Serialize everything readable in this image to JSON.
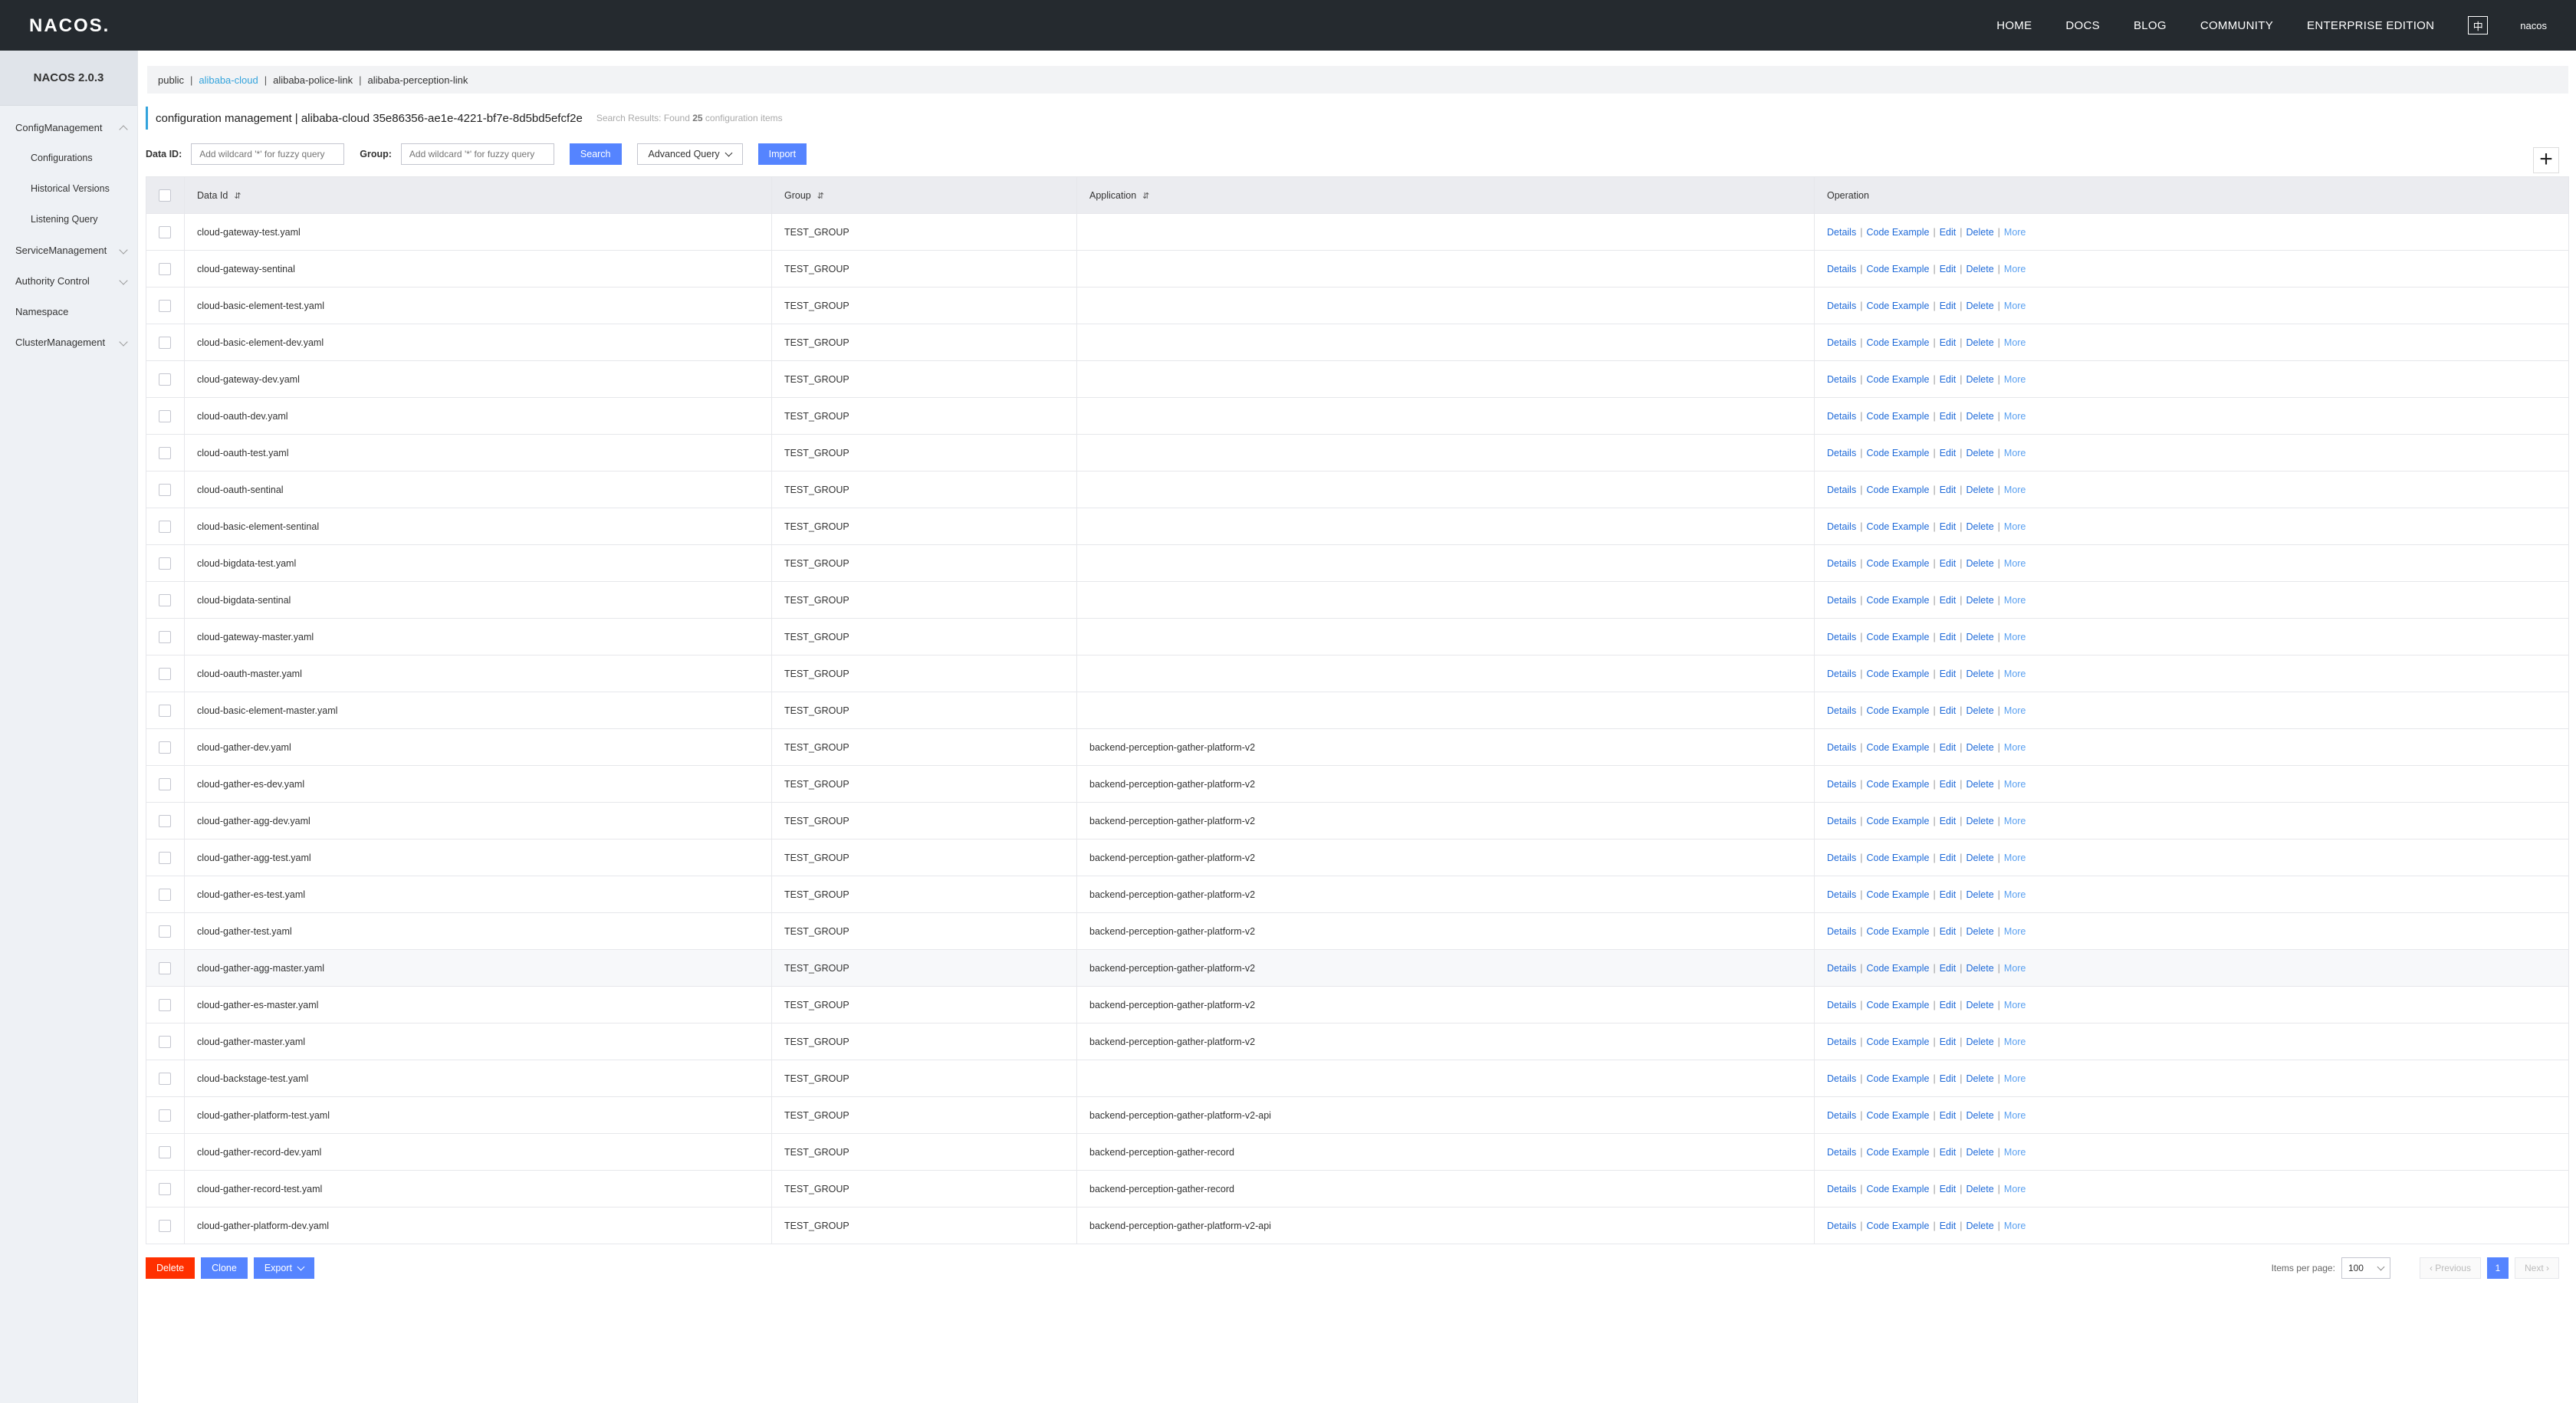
{
  "header": {
    "logo": "NACOS.",
    "nav": [
      "HOME",
      "DOCS",
      "BLOG",
      "COMMUNITY",
      "ENTERPRISE EDITION"
    ],
    "lang": "中",
    "user": "nacos"
  },
  "sidebar": {
    "title": "NACOS 2.0.3",
    "items": [
      {
        "label": "ConfigManagement"
      },
      {
        "label": "Configurations"
      },
      {
        "label": "Historical Versions"
      },
      {
        "label": "Listening Query"
      },
      {
        "label": "ServiceManagement"
      },
      {
        "label": "Authority Control"
      },
      {
        "label": "Namespace"
      },
      {
        "label": "ClusterManagement"
      }
    ]
  },
  "namespaces": [
    "public",
    "alibaba-cloud",
    "alibaba-police-link",
    "alibaba-perception-link"
  ],
  "title": {
    "main": "configuration management  |  alibaba-cloud  35e86356-ae1e-4221-bf7e-8d5bd5efcf2e",
    "summary_prefix": "Search Results: Found",
    "count": "25",
    "summary_suffix": "configuration items"
  },
  "search": {
    "data_id_label": "Data ID:",
    "data_id_placeholder": "Add wildcard '*' for fuzzy query",
    "group_label": "Group:",
    "group_placeholder": "Add wildcard '*' for fuzzy query",
    "search_btn": "Search",
    "advanced_btn": "Advanced Query",
    "import_btn": "Import",
    "plus": "+"
  },
  "table": {
    "columns": [
      "Data Id",
      "Group",
      "Application",
      "Operation"
    ],
    "sort_icon": "⇵",
    "ops": [
      "Details",
      "Code Example",
      "Edit",
      "Delete",
      "More"
    ],
    "rows": [
      {
        "data_id": "cloud-gateway-test.yaml",
        "group": "TEST_GROUP",
        "app": ""
      },
      {
        "data_id": "cloud-gateway-sentinal",
        "group": "TEST_GROUP",
        "app": ""
      },
      {
        "data_id": "cloud-basic-element-test.yaml",
        "group": "TEST_GROUP",
        "app": ""
      },
      {
        "data_id": "cloud-basic-element-dev.yaml",
        "group": "TEST_GROUP",
        "app": ""
      },
      {
        "data_id": "cloud-gateway-dev.yaml",
        "group": "TEST_GROUP",
        "app": ""
      },
      {
        "data_id": "cloud-oauth-dev.yaml",
        "group": "TEST_GROUP",
        "app": ""
      },
      {
        "data_id": "cloud-oauth-test.yaml",
        "group": "TEST_GROUP",
        "app": ""
      },
      {
        "data_id": "cloud-oauth-sentinal",
        "group": "TEST_GROUP",
        "app": ""
      },
      {
        "data_id": "cloud-basic-element-sentinal",
        "group": "TEST_GROUP",
        "app": ""
      },
      {
        "data_id": "cloud-bigdata-test.yaml",
        "group": "TEST_GROUP",
        "app": ""
      },
      {
        "data_id": "cloud-bigdata-sentinal",
        "group": "TEST_GROUP",
        "app": ""
      },
      {
        "data_id": "cloud-gateway-master.yaml",
        "group": "TEST_GROUP",
        "app": ""
      },
      {
        "data_id": "cloud-oauth-master.yaml",
        "group": "TEST_GROUP",
        "app": ""
      },
      {
        "data_id": "cloud-basic-element-master.yaml",
        "group": "TEST_GROUP",
        "app": ""
      },
      {
        "data_id": "cloud-gather-dev.yaml",
        "group": "TEST_GROUP",
        "app": "backend-perception-gather-platform-v2"
      },
      {
        "data_id": "cloud-gather-es-dev.yaml",
        "group": "TEST_GROUP",
        "app": "backend-perception-gather-platform-v2"
      },
      {
        "data_id": "cloud-gather-agg-dev.yaml",
        "group": "TEST_GROUP",
        "app": "backend-perception-gather-platform-v2"
      },
      {
        "data_id": "cloud-gather-agg-test.yaml",
        "group": "TEST_GROUP",
        "app": "backend-perception-gather-platform-v2"
      },
      {
        "data_id": "cloud-gather-es-test.yaml",
        "group": "TEST_GROUP",
        "app": "backend-perception-gather-platform-v2"
      },
      {
        "data_id": "cloud-gather-test.yaml",
        "group": "TEST_GROUP",
        "app": "backend-perception-gather-platform-v2"
      },
      {
        "data_id": "cloud-gather-agg-master.yaml",
        "group": "TEST_GROUP",
        "app": "backend-perception-gather-platform-v2"
      },
      {
        "data_id": "cloud-gather-es-master.yaml",
        "group": "TEST_GROUP",
        "app": "backend-perception-gather-platform-v2"
      },
      {
        "data_id": "cloud-gather-master.yaml",
        "group": "TEST_GROUP",
        "app": "backend-perception-gather-platform-v2"
      },
      {
        "data_id": "cloud-backstage-test.yaml",
        "group": "TEST_GROUP",
        "app": ""
      },
      {
        "data_id": "cloud-gather-platform-test.yaml",
        "group": "TEST_GROUP",
        "app": "backend-perception-gather-platform-v2-api"
      },
      {
        "data_id": "cloud-gather-record-dev.yaml",
        "group": "TEST_GROUP",
        "app": "backend-perception-gather-record"
      },
      {
        "data_id": "cloud-gather-record-test.yaml",
        "group": "TEST_GROUP",
        "app": "backend-perception-gather-record"
      },
      {
        "data_id": "cloud-gather-platform-dev.yaml",
        "group": "TEST_GROUP",
        "app": "backend-perception-gather-platform-v2-api"
      }
    ]
  },
  "footer": {
    "delete_btn": "Delete",
    "clone_btn": "Clone",
    "export_btn": "Export",
    "items_per_page_label": "Items per page:",
    "page_size": "100",
    "prev": "‹ Previous",
    "page": "1",
    "next": "Next ›"
  },
  "colors": {
    "topbar": "#252a2f",
    "accent": "#33a3dc",
    "primary": "#5584ff",
    "danger": "#ff3000",
    "link": "#1f6ad8"
  }
}
